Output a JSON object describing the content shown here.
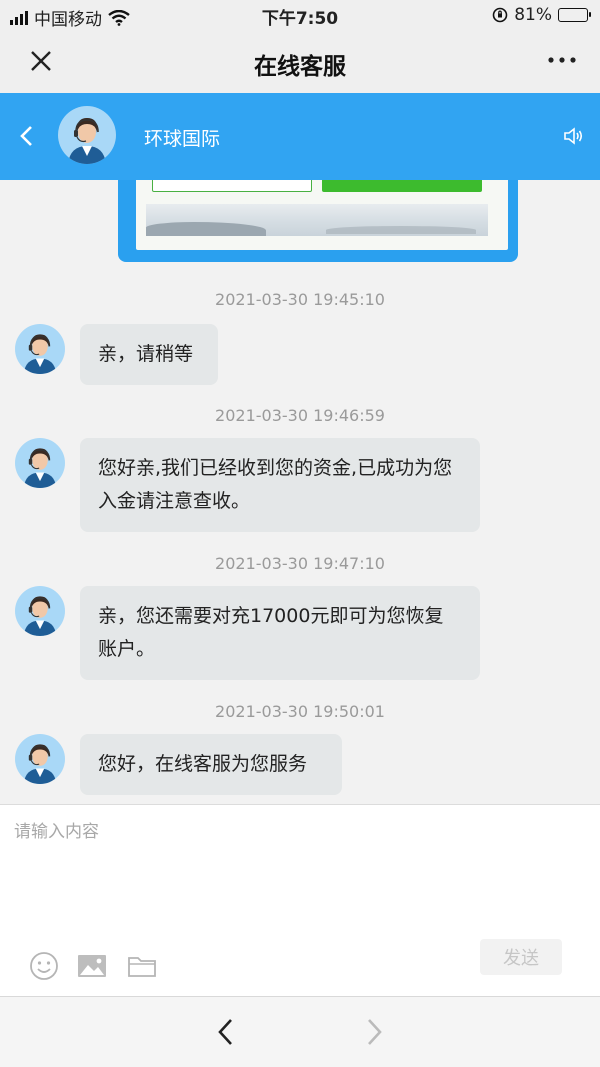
{
  "status_bar": {
    "carrier": "中国移动",
    "time": "下午7:50",
    "battery_percent": "81%",
    "battery_level": 0.81
  },
  "nav": {
    "title": "在线客服",
    "close_icon": "close-icon",
    "more_icon": "more-dots-icon"
  },
  "chat_header": {
    "title": "环球国际",
    "back_icon": "chevron-left-icon",
    "sound_icon": "speaker-icon",
    "accent_color": "#31a4f2"
  },
  "messages": [
    {
      "timestamp": "2021-03-30 19:45:10",
      "text": "亲，请稍等"
    },
    {
      "timestamp": "2021-03-30 19:46:59",
      "text": "您好亲,我们已经收到您的资金,已成功为您入金请注意查收。"
    },
    {
      "timestamp": "2021-03-30 19:47:10",
      "text": "亲，您还需要对充17000元即可为您恢复账户。"
    },
    {
      "timestamp": "2021-03-30 19:50:01",
      "text": "您好，在线客服为您服务"
    }
  ],
  "input": {
    "placeholder": "请输入内容",
    "value": "",
    "send_label": "发送",
    "tools": [
      "emoji-icon",
      "image-icon",
      "folder-icon"
    ]
  },
  "bottom_bar": {
    "back_icon": "arrow-left-icon",
    "forward_icon": "arrow-right-icon"
  }
}
